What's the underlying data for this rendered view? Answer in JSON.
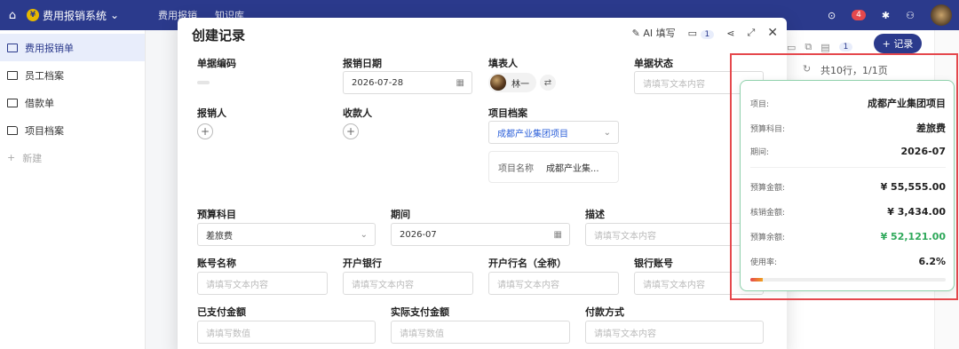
{
  "topbar": {
    "app_name": "费用报销系统",
    "tabs": [
      "费用报销",
      "知识库"
    ],
    "notification_count": "4"
  },
  "sidebar": {
    "items": [
      {
        "label": "费用报销单"
      },
      {
        "label": "员工档案"
      },
      {
        "label": "借款单"
      },
      {
        "label": "项目档案"
      },
      {
        "label": "新建"
      }
    ]
  },
  "background": {
    "record_button": "+ 记录",
    "count_badge": "1",
    "summary": "共10行，1/1页"
  },
  "modal": {
    "title": "创建记录",
    "ai_fill": "AI 填写",
    "inbox_count": "1",
    "fields": {
      "doc_no_label": "单据编码",
      "date_label": "报销日期",
      "date_value": "2026-07-28",
      "filler_label": "填表人",
      "filler_name": "林一",
      "status_label": "单据状态",
      "status_placeholder": "请填写文本内容",
      "reimburser_label": "报销人",
      "payee_label": "收款人",
      "project_label": "项目档案",
      "project_value": "成都产业集团项目",
      "project_name_key": "项目名称",
      "project_name_value": "成都产业集...",
      "budget_label": "预算科目",
      "budget_value": "差旅费",
      "period_label": "期间",
      "period_value": "2026-07",
      "desc_label": "描述",
      "desc_placeholder": "请填写文本内容",
      "account_name_label": "账号名称",
      "account_name_placeholder": "请填写文本内容",
      "bank_label": "开户银行",
      "bank_placeholder": "请填写文本内容",
      "bank_full_label": "开户行名（全称）",
      "bank_full_placeholder": "请填写文本内容",
      "bank_account_label": "银行账号",
      "bank_account_placeholder": "请填写文本内容",
      "paid_label": "已支付金额",
      "paid_placeholder": "请填写数值",
      "actual_paid_label": "实际支付金额",
      "actual_paid_placeholder": "请填写数值",
      "pay_method_label": "付款方式",
      "pay_method_placeholder": "请填写文本内容"
    }
  },
  "popover": {
    "project_key": "项目:",
    "project_value": "成都产业集团项目",
    "budget_key": "预算科目:",
    "budget_value": "差旅费",
    "period_key": "期间:",
    "period_value": "2026-07",
    "budget_amount_key": "预算金额:",
    "budget_amount_value": "¥ 55,555.00",
    "spent_key": "核销金额:",
    "spent_value": "¥ 3,434.00",
    "remaining_key": "预算余额:",
    "remaining_value": "¥ 52,121.00",
    "usage_key": "使用率:",
    "usage_value": "6.2%",
    "usage_fraction": 0.062
  },
  "colors": {
    "brand": "#2b3a8c",
    "highlight": "#e5484d",
    "positive": "#2ea85a"
  }
}
